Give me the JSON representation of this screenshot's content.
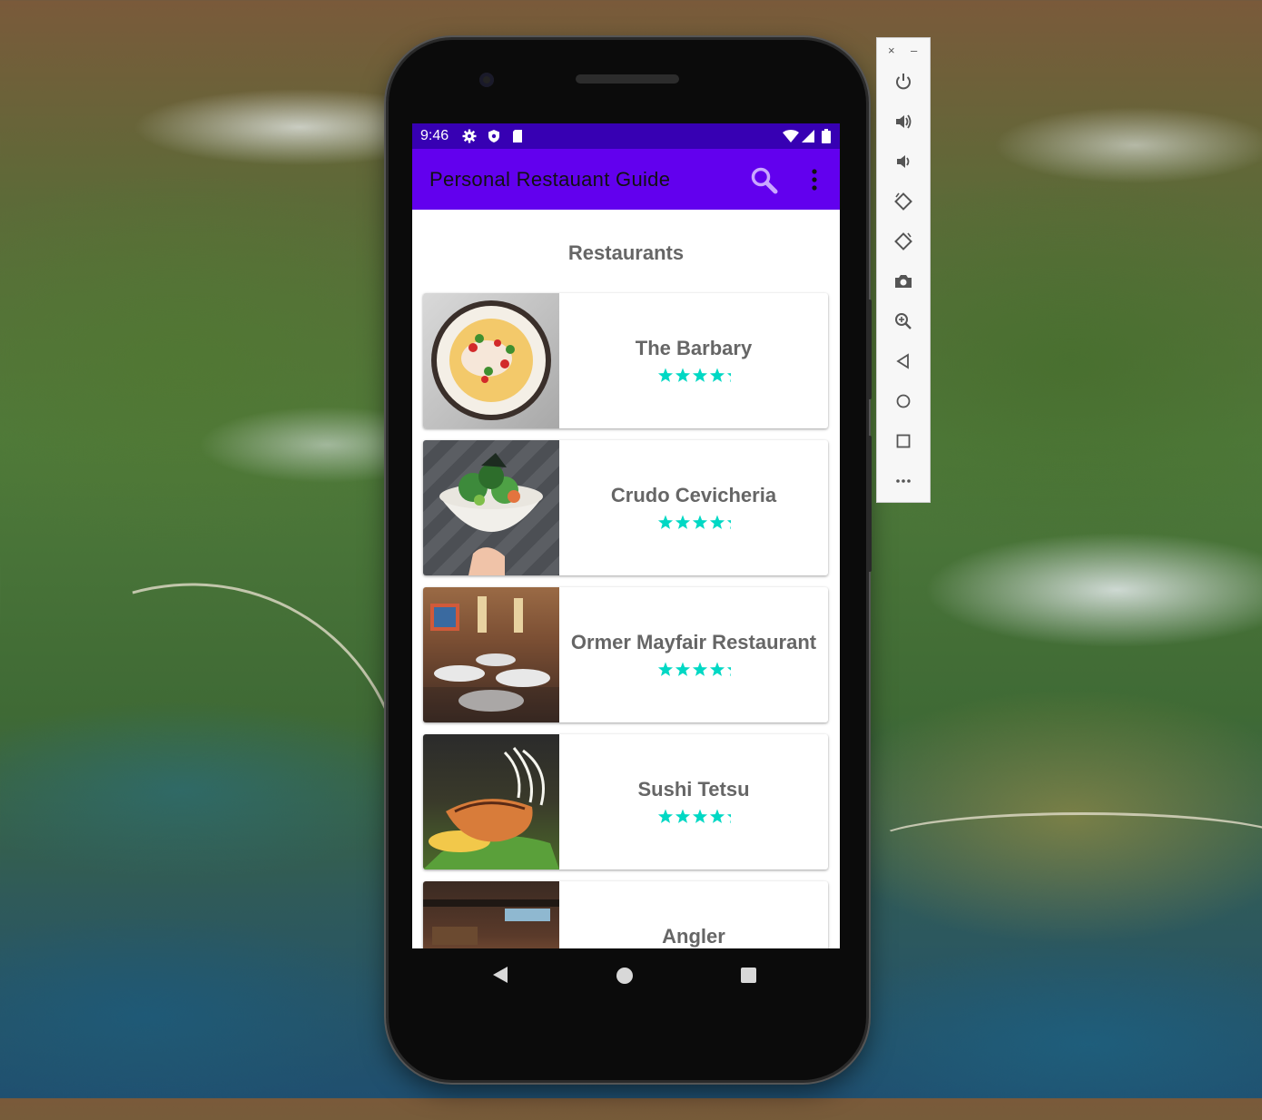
{
  "status_bar": {
    "time": "9:46"
  },
  "app_bar": {
    "title": "Personal Restauant Guide"
  },
  "section_title": "Restaurants",
  "restaurants": [
    {
      "name": "The Barbary",
      "rating": 4.5
    },
    {
      "name": "Crudo Cevicheria",
      "rating": 4.5
    },
    {
      "name": "Ormer Mayfair Restaurant",
      "rating": 4.5
    },
    {
      "name": "Sushi Tetsu",
      "rating": 4.5
    },
    {
      "name": "Angler"
    }
  ],
  "colors": {
    "status_bar": "#3700b3",
    "app_bar": "#6200ee",
    "star": "#00d8c4",
    "text_secondary": "#666666"
  },
  "emulator_toolbar": {
    "close_glyph": "×",
    "minimize_glyph": "–",
    "icons": [
      "power-icon",
      "volume-up-icon",
      "volume-down-icon",
      "rotate-left-icon",
      "rotate-right-icon",
      "camera-icon",
      "zoom-icon",
      "back-icon",
      "home-icon",
      "overview-icon",
      "more-icon"
    ]
  }
}
